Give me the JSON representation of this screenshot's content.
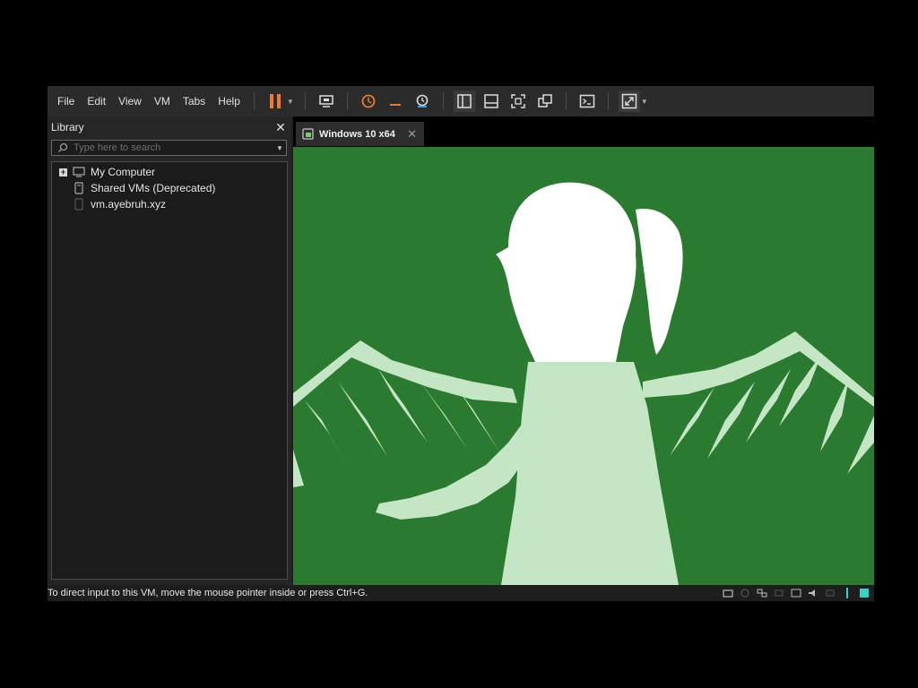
{
  "menu": [
    "File",
    "Edit",
    "View",
    "VM",
    "Tabs",
    "Help"
  ],
  "library": {
    "title": "Library",
    "search_placeholder": "Type here to search",
    "tree": [
      {
        "label": "My Computer",
        "icon": "computer-icon"
      },
      {
        "label": "Shared VMs (Deprecated)",
        "icon": "shared-vms-icon"
      },
      {
        "label": "vm.ayebruh.xyz",
        "icon": "remote-host-icon"
      }
    ]
  },
  "tab": {
    "label": "Windows 10 x64",
    "icon": "vm-tab-icon"
  },
  "status": {
    "message": "To direct input to this VM, move the mouse pointer inside or press Ctrl+G."
  },
  "colors": {
    "accent": "#f07a2a",
    "vm_background": "#2a7a2f",
    "silhouette_front": "#ffffff",
    "silhouette_back": "#c4e6c4",
    "status_active": "#39d0c5"
  },
  "icons": {
    "toolbar": [
      "pause-icon",
      "send-ctrl-alt-del-icon",
      "snapshot-icon",
      "revert-snapshot-icon",
      "snapshot-manager-icon",
      "library-view-icon",
      "thumbnail-view-icon",
      "full-screen-icon",
      "unity-icon",
      "console-view-icon",
      "stretch-guest-icon"
    ],
    "status": [
      "hard-disk-icon",
      "cd-dvd-icon",
      "network-icon",
      "usb-icon",
      "sound-icon",
      "printer-icon",
      "display-icon",
      "message-icon",
      "vm-status-icon"
    ]
  }
}
